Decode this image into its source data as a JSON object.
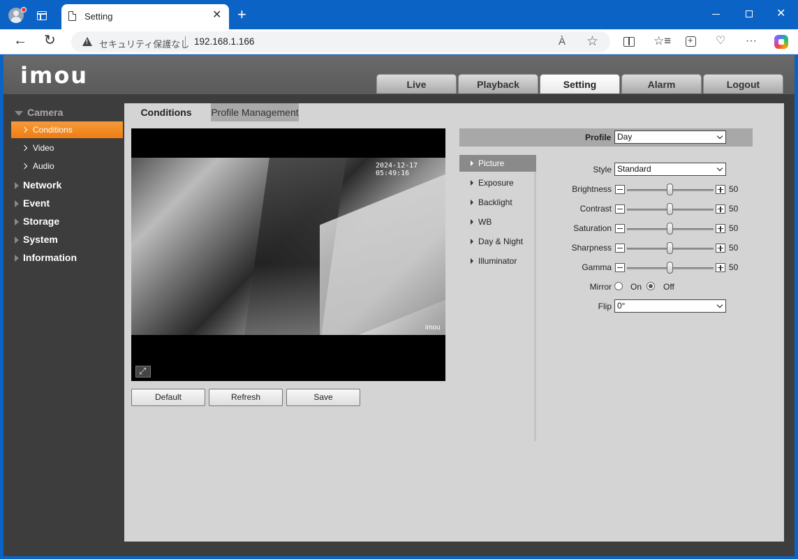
{
  "browser": {
    "tab_title": "Setting",
    "tab_close": "✕",
    "new_tab": "+",
    "security_text": "セキュリティ保護なし",
    "url": "192.168.1.166",
    "read_aloud": "À",
    "favorite": "☆",
    "back": "←",
    "refresh": "↻",
    "more": "···",
    "window_close": "✕"
  },
  "header": {
    "logo": "imou",
    "nav_tabs": [
      "Live",
      "Playback",
      "Setting",
      "Alarm",
      "Logout"
    ],
    "active_tab": "Setting"
  },
  "sidebar": {
    "camera": "Camera",
    "camera_items": [
      "Conditions",
      "Video",
      "Audio"
    ],
    "active_item": "Conditions",
    "sections": [
      "Network",
      "Event",
      "Storage",
      "System",
      "Information"
    ]
  },
  "subtabs": [
    "Conditions",
    "Profile Management"
  ],
  "video": {
    "timestamp": "2024-12-17 05:49:16",
    "watermark": "imou"
  },
  "actions": {
    "default": "Default",
    "refresh": "Refresh",
    "save": "Save"
  },
  "profile": {
    "label": "Profile",
    "value": "Day"
  },
  "menu": [
    "Picture",
    "Exposure",
    "Backlight",
    "WB",
    "Day & Night",
    "Illuminator"
  ],
  "active_menu": "Picture",
  "picture": {
    "style_label": "Style",
    "style_value": "Standard",
    "sliders": [
      {
        "label": "Brightness",
        "value": "50"
      },
      {
        "label": "Contrast",
        "value": "50"
      },
      {
        "label": "Saturation",
        "value": "50"
      },
      {
        "label": "Sharpness",
        "value": "50"
      },
      {
        "label": "Gamma",
        "value": "50"
      }
    ],
    "mirror_label": "Mirror",
    "mirror_on": "On",
    "mirror_off": "Off",
    "mirror_value": "Off",
    "flip_label": "Flip",
    "flip_value": "0°"
  }
}
